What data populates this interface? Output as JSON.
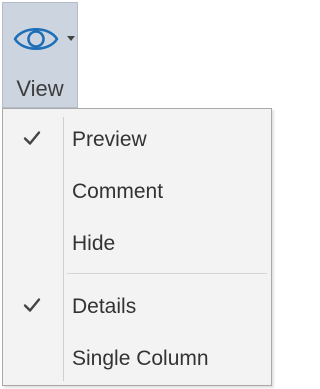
{
  "ribbon": {
    "view_button": {
      "label": "View",
      "icon": "eye-icon",
      "has_dropdown": true
    }
  },
  "menu": {
    "groups": [
      {
        "items": [
          {
            "label": "Preview",
            "checked": true
          },
          {
            "label": "Comment",
            "checked": false
          },
          {
            "label": "Hide",
            "checked": false
          }
        ]
      },
      {
        "items": [
          {
            "label": "Details",
            "checked": true
          },
          {
            "label": "Single Column",
            "checked": false
          }
        ]
      }
    ]
  },
  "colors": {
    "icon_accent": "#1e6fb8",
    "button_pressed_bg": "#ccd4df",
    "menu_bg": "#f3f3f3",
    "text": "#333333"
  }
}
